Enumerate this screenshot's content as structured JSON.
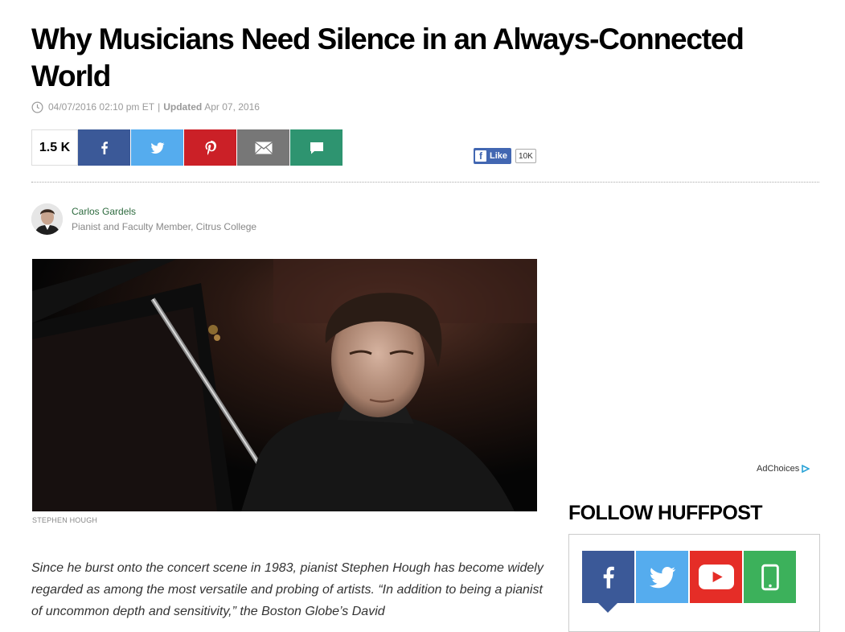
{
  "article": {
    "headline": "Why Musicians Need Silence in an Always-Connected World",
    "timestamp": "04/07/2016 02:10 pm ET",
    "separator": "|",
    "updated_label": "Updated",
    "updated_date": "Apr 07, 2016",
    "share_count": "1.5 K",
    "fb_like_label": "Like",
    "fb_like_count": "10K",
    "author_name": "Carlos Gardels",
    "author_bio": "Pianist and Faculty Member, Citrus College",
    "photo_caption": "STEPHEN HOUGH",
    "body_lead": "Since he burst onto the concert scene in 1983, pianist Stephen Hough has become widely regarded as among the most versatile and probing of artists. “In addition to being a pianist of uncommon depth and sensitivity,” the Boston Globe’s David"
  },
  "share_buttons": [
    {
      "name": "facebook",
      "icon": "facebook-icon",
      "color": "#3b5998"
    },
    {
      "name": "twitter",
      "icon": "twitter-icon",
      "color": "#55acee"
    },
    {
      "name": "pinterest",
      "icon": "pinterest-icon",
      "color": "#cb2027"
    },
    {
      "name": "email",
      "icon": "email-icon",
      "color": "#777777"
    },
    {
      "name": "comment",
      "icon": "comment-icon",
      "color": "#2e9470"
    }
  ],
  "sidebar": {
    "adchoices_label": "AdChoices",
    "follow_heading": "FOLLOW HUFFPOST",
    "follow_icons": [
      {
        "name": "facebook",
        "icon": "facebook-icon",
        "color": "#3b5998"
      },
      {
        "name": "twitter",
        "icon": "twitter-icon",
        "color": "#55acee"
      },
      {
        "name": "youtube",
        "icon": "youtube-icon",
        "color": "#e52d27"
      },
      {
        "name": "app",
        "icon": "mobile-app-icon",
        "color": "#3cb15b"
      }
    ]
  }
}
